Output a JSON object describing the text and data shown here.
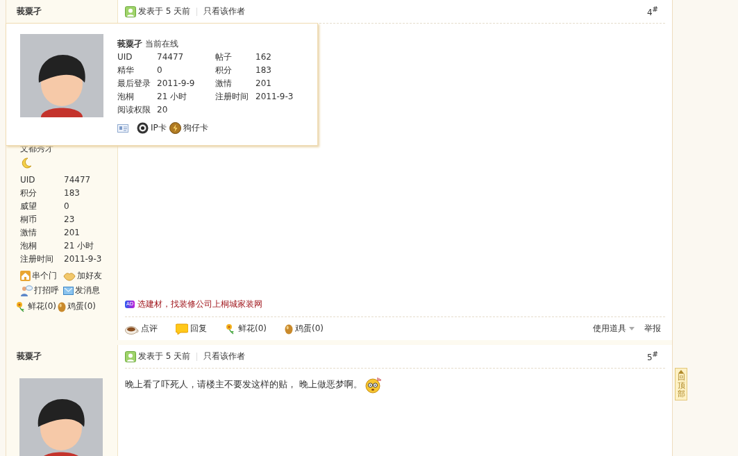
{
  "posts": [
    {
      "author": "莪粟孑",
      "rank": "文都秀才",
      "stats": [
        {
          "label": "UID",
          "value": "74477"
        },
        {
          "label": "积分",
          "value": "183"
        },
        {
          "label": "威望",
          "value": "0"
        },
        {
          "label": "桐币",
          "value": "23"
        },
        {
          "label": "激情",
          "value": "201"
        },
        {
          "label": "泡桐",
          "value": "21 小时"
        },
        {
          "label": "注册时间",
          "value": "2011-9-3"
        }
      ],
      "links": [
        {
          "kind": "home",
          "label": "串个门"
        },
        {
          "kind": "friend",
          "label": "加好友"
        },
        {
          "kind": "greet",
          "label": "打招呼"
        },
        {
          "kind": "mail",
          "label": "发消息"
        }
      ],
      "gifts": [
        {
          "kind": "flower",
          "label": "鲜花(0)"
        },
        {
          "kind": "egg",
          "label": "鸡蛋(0)"
        }
      ],
      "posted": "发表于 5 天前",
      "author_only": "只看该作者",
      "floor": "4$^{#}$",
      "ad": {
        "badge": "AD",
        "text": "选建材，找装修公司上桐城家装网"
      },
      "actions": [
        {
          "kind": "comment",
          "label": "点评"
        },
        {
          "kind": "reply",
          "label": "回复"
        },
        {
          "kind": "flower",
          "label": "鲜花(0)"
        },
        {
          "kind": "egg",
          "label": "鸡蛋(0)"
        }
      ],
      "tools": "使用道具",
      "report": "举报"
    },
    {
      "author": "莪粟孑",
      "avatar": true,
      "posted": "发表于 5 天前",
      "author_only": "只看该作者",
      "floor": "5$^{#}$",
      "content": "晚上看了吓死人，请楼主不要发这样的贴， 晚上做恶梦啊。",
      "emoji": true
    }
  ],
  "user_card": {
    "name": "莪粟孑",
    "status": "当前在线",
    "stats": [
      {
        "label": "UID",
        "value": "74477"
      },
      {
        "label": "帖子",
        "value": "162"
      },
      {
        "label": "精华",
        "value": "0"
      },
      {
        "label": "积分",
        "value": "183"
      },
      {
        "label": "最后登录",
        "value": "2011-9-9"
      },
      {
        "label": "激情",
        "value": "201"
      },
      {
        "label": "泡桐",
        "value": "21 小时"
      },
      {
        "label": "注册时间",
        "value": "2011-9-3"
      },
      {
        "label": "阅读权限",
        "value": "20"
      }
    ],
    "cards": [
      {
        "kind": "profile"
      },
      {
        "kind": "ip",
        "label": "IP卡"
      },
      {
        "kind": "dog",
        "label": "狗仔卡"
      }
    ]
  },
  "back_to_top": "回顶部"
}
